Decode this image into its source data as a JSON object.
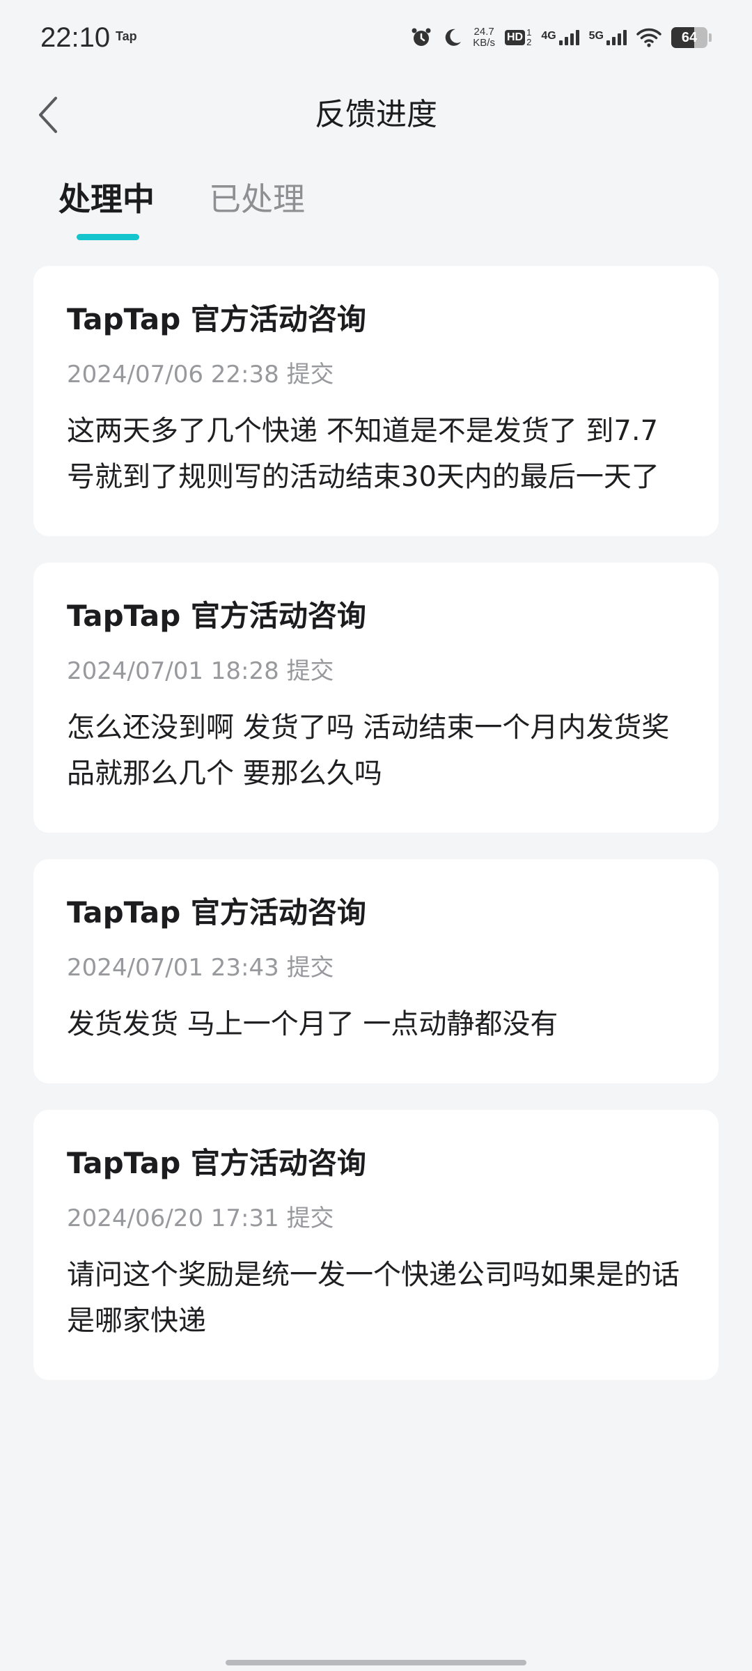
{
  "status_bar": {
    "time": "22:10",
    "app_label": "Tap",
    "net_speed_value": "24.7",
    "net_speed_unit": "KB/s",
    "hd_label": "HD",
    "hd_sub_top": "1",
    "hd_sub_bottom": "2",
    "signal_1_label": "4G",
    "signal_2_label": "5G",
    "battery_level": "64",
    "battery_fraction": 0.64
  },
  "header": {
    "title": "反馈进度"
  },
  "tabs": [
    {
      "label": "处理中",
      "active": true
    },
    {
      "label": "已处理",
      "active": false
    }
  ],
  "accent_color": "#15c5ce",
  "cards": [
    {
      "title": "TapTap 官方活动咨询",
      "time": "2024/07/06 22:38 提交",
      "body": "这两天多了几个快递 不知道是不是发货了 到7.7号就到了规则写的活动结束30天内的最后一天了"
    },
    {
      "title": "TapTap 官方活动咨询",
      "time": "2024/07/01 18:28 提交",
      "body": "怎么还没到啊 发货了吗 活动结束一个月内发货奖品就那么几个 要那么久吗"
    },
    {
      "title": "TapTap 官方活动咨询",
      "time": "2024/07/01 23:43 提交",
      "body": "发货发货 马上一个月了 一点动静都没有"
    },
    {
      "title": "TapTap 官方活动咨询",
      "time": "2024/06/20 17:31 提交",
      "body": "请问这个奖励是统一发一个快递公司吗如果是的话是哪家快递"
    }
  ]
}
